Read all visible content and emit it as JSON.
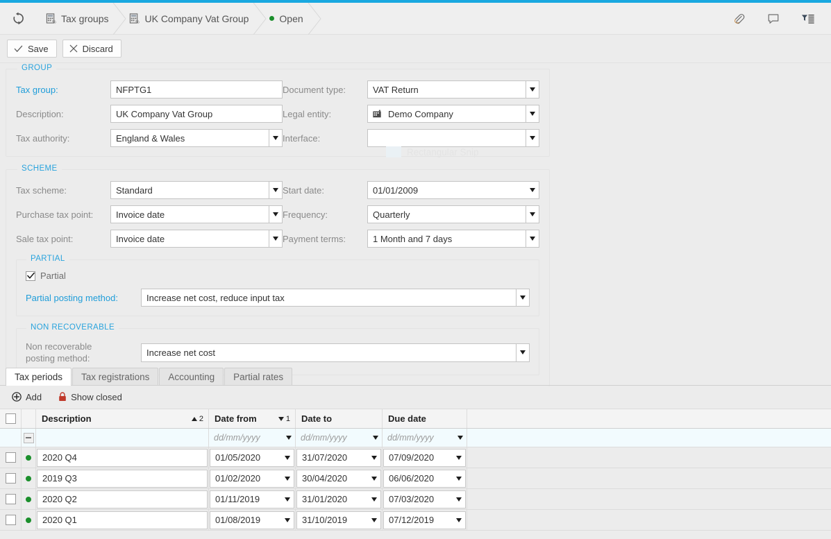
{
  "theme": {
    "accent": "#19a8e0",
    "link": "#1f9dd9",
    "status_green": "#1b8f2c",
    "lock_red": "#c0392b"
  },
  "topbar": {
    "refresh_icon": "refresh-icon",
    "crumbs": [
      {
        "label": "Tax groups",
        "icon": "tax-calculator-icon"
      },
      {
        "label": "UK Company Vat Group",
        "icon": "tax-calculator-icon"
      },
      {
        "label": "Open",
        "icon": "status-dot-icon"
      }
    ],
    "icons": [
      {
        "name": "attachment-icon",
        "title": "Attachments"
      },
      {
        "name": "comment-icon",
        "title": "Notes"
      },
      {
        "name": "filter-list-icon",
        "title": "Filter"
      }
    ]
  },
  "actions": {
    "save_label": "Save",
    "discard_label": "Discard"
  },
  "group": {
    "legend": "GROUP",
    "fields": {
      "tax_group": {
        "label": "Tax group:",
        "value": "NFPTG1"
      },
      "description": {
        "label": "Description:",
        "value": "UK Company Vat Group"
      },
      "tax_authority": {
        "label": "Tax authority:",
        "value": "England & Wales"
      },
      "document_type": {
        "label": "Document type:",
        "value": "VAT Return"
      },
      "legal_entity": {
        "label": "Legal entity:",
        "value": "Demo Company"
      },
      "interface": {
        "label": "Interface:",
        "value": ""
      }
    }
  },
  "scheme": {
    "legend": "SCHEME",
    "fields": {
      "tax_scheme": {
        "label": "Tax scheme:",
        "value": "Standard"
      },
      "purchase_tax_point": {
        "label": "Purchase tax point:",
        "value": "Invoice date"
      },
      "sale_tax_point": {
        "label": "Sale tax point:",
        "value": "Invoice date"
      },
      "start_date": {
        "label": "Start date:",
        "value": "01/01/2009"
      },
      "frequency": {
        "label": "Frequency:",
        "value": "Quarterly"
      },
      "payment_terms": {
        "label": "Payment terms:",
        "value": "1 Month and 7 days"
      }
    },
    "partial": {
      "legend": "PARTIAL",
      "checkbox_label": "Partial",
      "checked": true,
      "posting_method": {
        "label": "Partial posting method:",
        "value": "Increase net cost, reduce input tax"
      }
    },
    "non_recoverable": {
      "legend": "NON RECOVERABLE",
      "posting_method": {
        "label_line1": "Non recoverable",
        "label_line2": "posting method:",
        "value": "Increase net cost"
      }
    }
  },
  "tabs": [
    {
      "label": "Tax periods",
      "active": true
    },
    {
      "label": "Tax registrations",
      "active": false
    },
    {
      "label": "Accounting",
      "active": false
    },
    {
      "label": "Partial rates",
      "active": false
    }
  ],
  "grid_toolbar": {
    "add_label": "Add",
    "show_closed_label": "Show closed"
  },
  "grid": {
    "columns": [
      {
        "key": "description",
        "label": "Description",
        "sort": {
          "dir": "asc",
          "order": "2"
        }
      },
      {
        "key": "date_from",
        "label": "Date from",
        "sort": {
          "dir": "desc",
          "order": "1"
        }
      },
      {
        "key": "date_to",
        "label": "Date to",
        "sort": null
      },
      {
        "key": "due_date",
        "label": "Due date",
        "sort": null
      }
    ],
    "filter_row": {
      "description_placeholder": "",
      "date_from_placeholder": "dd/mm/yyyy",
      "date_to_placeholder": "dd/mm/yyyy",
      "due_date_placeholder": "dd/mm/yyyy"
    },
    "rows": [
      {
        "description": "2020 Q4",
        "date_from": "01/05/2020",
        "date_to": "31/07/2020",
        "due_date": "07/09/2020",
        "status": "open"
      },
      {
        "description": "2019 Q3",
        "date_from": "01/02/2020",
        "date_to": "30/04/2020",
        "due_date": "06/06/2020",
        "status": "open"
      },
      {
        "description": "2020 Q2",
        "date_from": "01/11/2019",
        "date_to": "31/01/2020",
        "due_date": "07/03/2020",
        "status": "open"
      },
      {
        "description": "2020 Q1",
        "date_from": "01/08/2019",
        "date_to": "31/10/2019",
        "due_date": "07/12/2019",
        "status": "open"
      }
    ]
  },
  "artifacts": {
    "snip_ghost_label": "Rectangular Snip"
  }
}
